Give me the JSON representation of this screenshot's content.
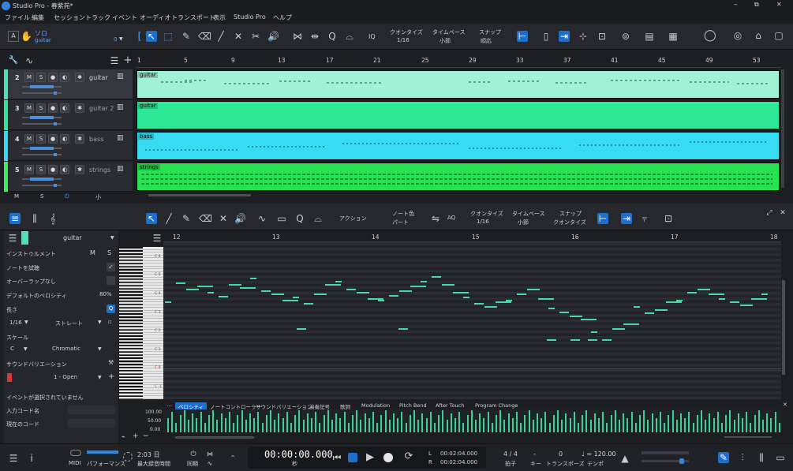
{
  "window": {
    "title": "Studio Pro - 春紫苑*",
    "controls": [
      "–",
      "⧉",
      "✕"
    ]
  },
  "menu": [
    "ファイル",
    "編集",
    "セッション",
    "トラック",
    "イベント",
    "オーディオ",
    "トランスポート",
    "表示",
    "Studio Pro",
    "ヘルプ"
  ],
  "toolbar": {
    "solo_label": "ソロ",
    "track_label": "guitar",
    "count": "0",
    "quantize_label": "クオンタイズ",
    "quantize_value": "1/16",
    "timebase_label": "タイムベース",
    "timebase_value": "小節",
    "snap_label": "スナップ",
    "snap_value": "順応",
    "iq": "IQ"
  },
  "arranger": {
    "ruler": [
      "1",
      "5",
      "9",
      "13",
      "17",
      "21",
      "25",
      "29",
      "33",
      "37",
      "41",
      "45",
      "49",
      "53"
    ],
    "tracks": [
      {
        "num": "2",
        "name": "guitar",
        "color": "#4fe0b5",
        "clip_color": "#9ff2d5",
        "clip_label": "guitar"
      },
      {
        "num": "3",
        "name": "guitar 2",
        "color": "#31e39a",
        "clip_color": "#2fe897",
        "clip_label": "guitar"
      },
      {
        "num": "4",
        "name": "bass",
        "color": "#33d9f0",
        "clip_color": "#38dcf2",
        "clip_label": "bass"
      },
      {
        "num": "5",
        "name": "strings",
        "color": "#3ded5c",
        "clip_color": "#27e251",
        "clip_label": "strings"
      }
    ],
    "footer": [
      "M",
      "S",
      "⏻",
      "小"
    ]
  },
  "editor": {
    "toolbar": {
      "action_label": "アクション",
      "notecolor_label": "ノート色",
      "notecolor_value": "パート",
      "aq": "AQ",
      "quantize_label": "クオンタイズ",
      "quantize_value": "1/16",
      "timebase_label": "タイムベース",
      "timebase_value": "小節",
      "snap_label": "スナップ",
      "snap_value": "クオンタイズ"
    },
    "inspector": {
      "track": "guitar",
      "instrument": "インストゥルメント",
      "m": "M",
      "s": "S",
      "preview": "ノートを試聴",
      "overlap": "オーバーラップなし",
      "default_vel_label": "デフォルトのベロシティ",
      "default_vel": "80%",
      "length_label": "長さ",
      "length_value": "1/16",
      "length_mode": "ストレート",
      "scale_label": "スケール",
      "scale_root": "C",
      "scale_type": "Chromatic",
      "sound_var_label": "サウンドバリエーション",
      "sound_var_value": "1 - Open",
      "no_event": "イベントが選択されていません",
      "input_chord": "入力コード名",
      "current_chord": "現在のコード"
    },
    "ruler": [
      "12",
      "13",
      "14",
      "15",
      "16",
      "17",
      "18"
    ],
    "keys": [
      "C 6",
      "C 5",
      "C 4",
      "C 3",
      "C 2",
      "C 1",
      "C 0",
      "C -1"
    ],
    "vel_scale": [
      "100.00",
      "50.00",
      "0.00"
    ],
    "lanes": [
      "ベロシティ",
      "ノートコントローラー",
      "サウンドバリエーション",
      "演奏記号",
      "歌詞",
      "Modulation",
      "Pitch Bend",
      "After Touch",
      "Program Change"
    ]
  },
  "transport": {
    "midi": "MIDI",
    "perf": "パフォーマンス",
    "rec_time": "2:03 日",
    "rec_label": "最大録音時間",
    "sync": "同期",
    "time": "00:00:00.000",
    "time_unit": "秒",
    "loop_l": "00:02:04.000",
    "loop_r": "00:02:04.000",
    "l": "L",
    "r": "R",
    "sig": "4 / 4",
    "sig_label": "拍子",
    "key": "-",
    "key_label": "キー",
    "transpose": "0",
    "transpose_label": "トランスポーズ",
    "tempo": "♩ = 120.00",
    "tempo_label": "テンポ"
  }
}
